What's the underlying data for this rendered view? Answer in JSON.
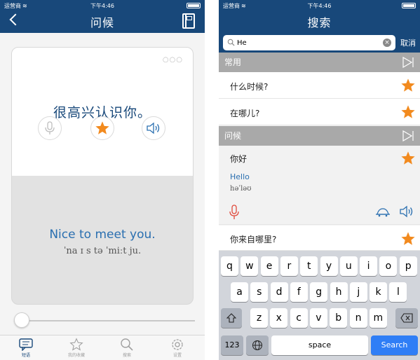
{
  "left": {
    "status": {
      "carrier": "运营商",
      "time": "下午4:46"
    },
    "nav": {
      "title": "问候"
    },
    "card": {
      "zh": "很高兴认识你。",
      "en": "Nice to meet you.",
      "ipa": "ˈna ɪ s tə ˈmiːt ju."
    },
    "tabs": [
      {
        "label": "短语"
      },
      {
        "label": "我的收藏"
      },
      {
        "label": "搜索"
      },
      {
        "label": "设置"
      }
    ]
  },
  "right": {
    "status": {
      "carrier": "运营商",
      "time": "下午4:46"
    },
    "nav": {
      "title": "搜索"
    },
    "search": {
      "value": "He",
      "cancel": "取消"
    },
    "sections": [
      {
        "title": "常用",
        "items": [
          {
            "zh": "什么时候?"
          },
          {
            "zh": "在哪儿?"
          }
        ]
      },
      {
        "title": "问候",
        "items": [
          {
            "zh": "你好",
            "en": "Hello",
            "ipa": "həˈləʊ"
          },
          {
            "zh": "你来自哪里?"
          }
        ]
      }
    ],
    "keyboard": {
      "row1": [
        "q",
        "w",
        "e",
        "r",
        "t",
        "y",
        "u",
        "i",
        "o",
        "p"
      ],
      "row2": [
        "a",
        "s",
        "d",
        "f",
        "g",
        "h",
        "j",
        "k",
        "l"
      ],
      "row3": [
        "z",
        "x",
        "c",
        "v",
        "b",
        "n",
        "m"
      ],
      "num": "123",
      "space": "space",
      "search": "Search"
    }
  },
  "colors": {
    "nav": "#18487a",
    "accent": "#f28a1e",
    "link": "#2a6fb0",
    "section": "#a9a9a9"
  }
}
